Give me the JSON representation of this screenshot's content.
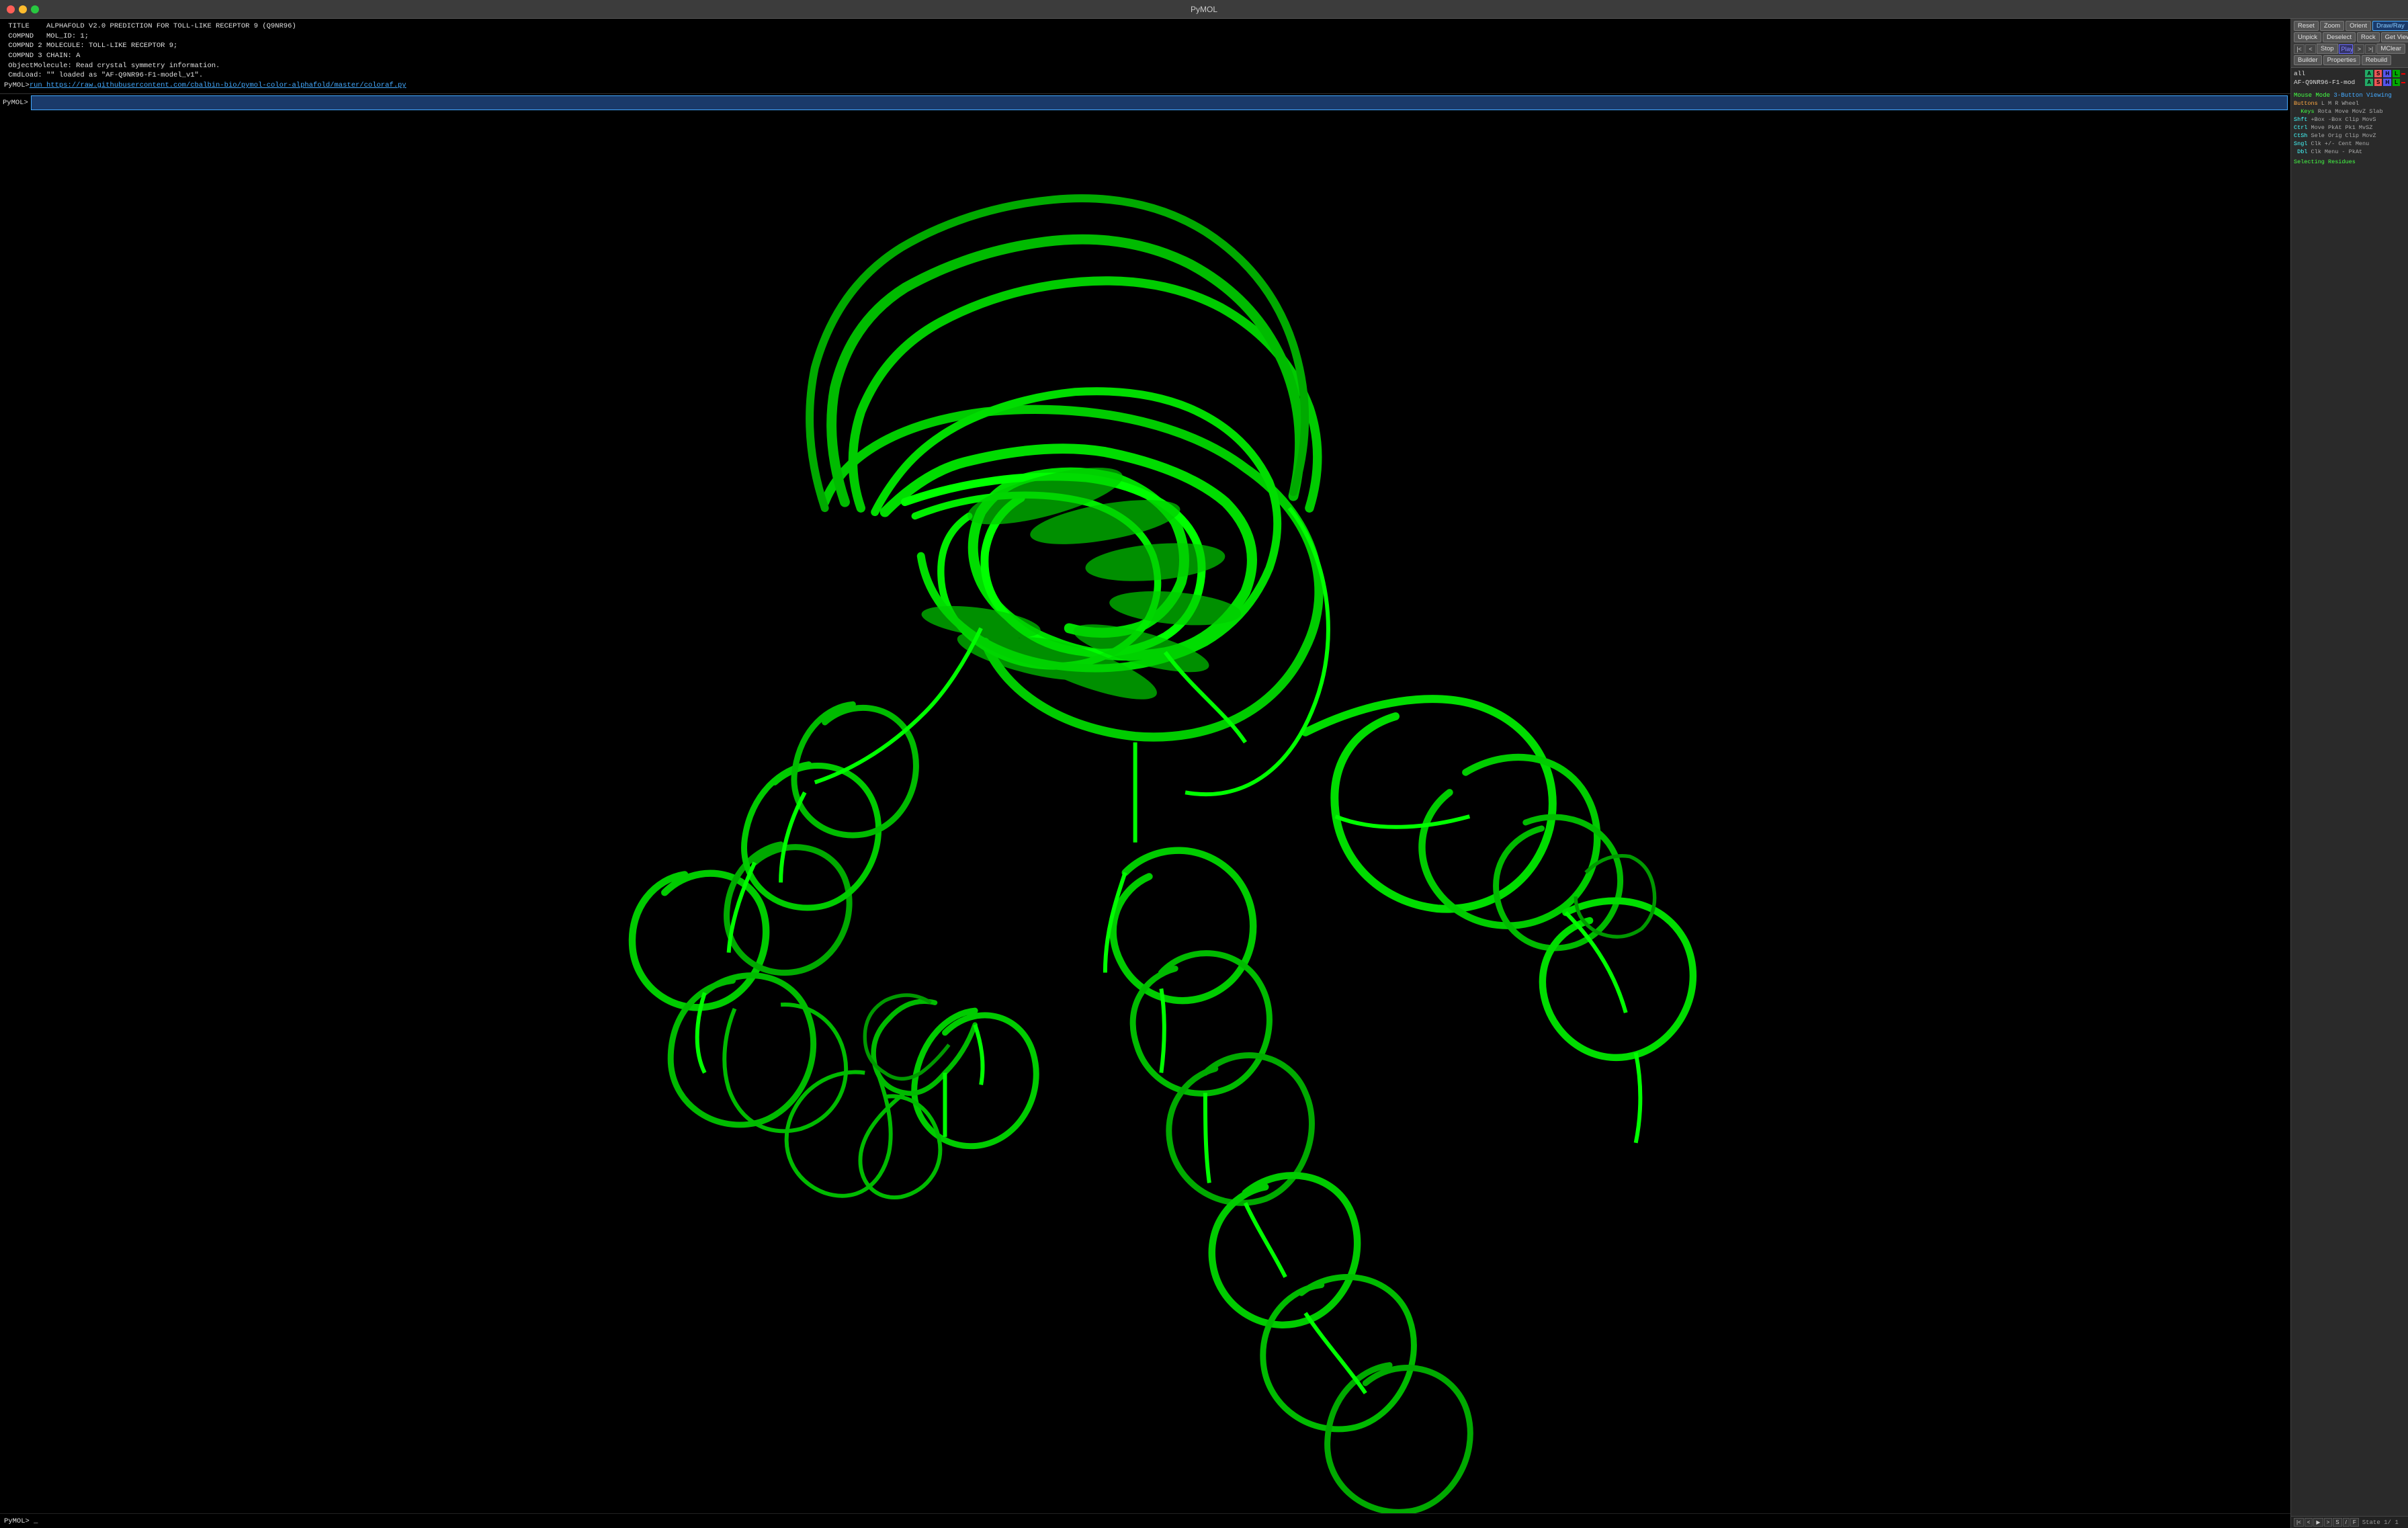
{
  "window": {
    "title": "PyMOL"
  },
  "log": {
    "lines": [
      {
        "text": " TITLE    ALPHAFOLD V2.0 PREDICTION FOR TOLL-LIKE RECEPTOR 9 (Q9NR96)",
        "type": "normal"
      },
      {
        "text": " COMPND   MOL_ID: 1;",
        "type": "normal"
      },
      {
        "text": " COMPND 2 MOLECULE: TOLL-LIKE RECEPTOR 9;",
        "type": "normal"
      },
      {
        "text": " COMPND 3 CHAIN: A",
        "type": "normal"
      },
      {
        "text": " ObjectMolecule: Read crystal symmetry information.",
        "type": "normal"
      },
      {
        "text": " CmdLoad: \"\" loaded as \"AF-Q9NR96-F1-model_v1\".",
        "type": "normal"
      },
      {
        "text": "PyMOL>run https://raw.githubusercontent.com/cbalbin-bio/pymol-color-alphafold/master/coloraf.py",
        "type": "url"
      }
    ]
  },
  "command": {
    "prompt": "PyMOL>",
    "input_value": "",
    "placeholder": ""
  },
  "toolbar": {
    "row1": [
      {
        "label": "Reset",
        "key": "reset-btn"
      },
      {
        "label": "Zoom",
        "key": "zoom-btn"
      },
      {
        "label": "Orient",
        "key": "orient-btn"
      },
      {
        "label": "Draw/Ray",
        "key": "drawray-btn",
        "style": "draw-ray"
      }
    ],
    "row2": [
      {
        "label": "Unpick",
        "key": "unpick-btn"
      },
      {
        "label": "Deselect",
        "key": "deselect-btn"
      },
      {
        "label": "Rock",
        "key": "rock-btn"
      },
      {
        "label": "Get View",
        "key": "getview-btn"
      }
    ],
    "row3_play": [
      {
        "label": "|<",
        "key": "rewind-btn"
      },
      {
        "label": "<",
        "key": "prev-btn"
      },
      {
        "label": "Stop",
        "key": "stop-btn"
      },
      {
        "label": "Play",
        "key": "play-btn"
      },
      {
        "label": ">",
        "key": "next-btn"
      },
      {
        "label": ">|",
        "key": "fwd-btn"
      },
      {
        "label": "MClear",
        "key": "mclear-btn"
      }
    ],
    "row4": [
      {
        "label": "Builder",
        "key": "builder-btn"
      },
      {
        "label": "Properties",
        "key": "properties-btn"
      },
      {
        "label": "Rebuild",
        "key": "rebuild-btn"
      }
    ]
  },
  "objects": [
    {
      "name": "all",
      "buttons": [
        "A",
        "S",
        "H",
        "L",
        "colored"
      ]
    },
    {
      "name": "AF-Q9NR96-F1-mod",
      "buttons": [
        "A",
        "S",
        "H",
        "L",
        "colored"
      ]
    }
  ],
  "mouse_mode": {
    "title": "Mouse Mode 3-Button Viewing",
    "buttons_label": "Buttons  L    M    R  Wheel",
    "keys": [
      {
        "key": "",
        "val": "Keys Rota Move MovZ Slab"
      },
      {
        "key": "Shft",
        "val": "+Box -Box Clip MovS"
      },
      {
        "key": "Ctrl",
        "val": "Move PkAt Pk1  MvSZ"
      },
      {
        "key": "CtSh",
        "val": "Sele Orig Clip MovZ"
      },
      {
        "key": "Sngl",
        "val": "Clk +/- Cent Menu"
      },
      {
        "key": "Dbl",
        "val": "Clk Menu  -  PkAt"
      }
    ],
    "selecting": "Selecting Residues",
    "state_label": "State  1/    1"
  },
  "bottom_bar": {
    "prompt": "PyMOL> _"
  },
  "colors": {
    "bg": "#000000",
    "protein_green": "#00ff00",
    "accent_blue": "#4af",
    "panel_bg": "#2a2a2a",
    "toolbar_bg": "#3a3a3a"
  }
}
